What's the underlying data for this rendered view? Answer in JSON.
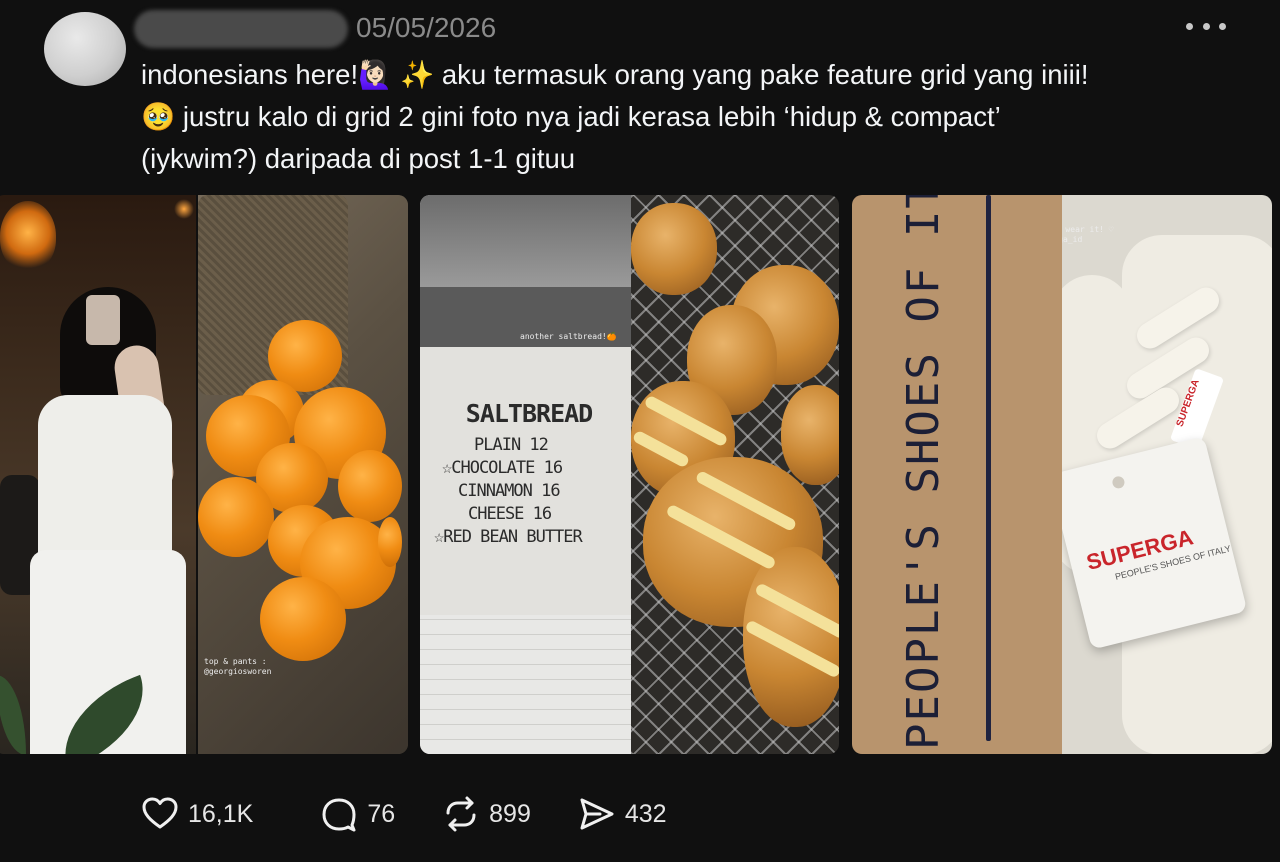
{
  "post": {
    "timestamp": "05/05/2026",
    "text_lines": [
      "indonesians here!🙋🏻‍♀️ ✨ aku termasuk orang yang pake feature grid yang iniii!",
      "🥹 justru kalo di grid 2 gini foto nya jadi kerasa lebih ‘hidup & compact’",
      "(iykwim?) daripada di post 1-1 gituu"
    ]
  },
  "media": [
    {
      "right_caption_lines": [
        "top & pants :",
        "@georgiosworen"
      ]
    },
    {
      "caption": "another saltbread!🍊",
      "menu_title": "SALTBREAD",
      "menu_lines": [
        "PLAIN 12",
        "☆CHOCOLATE 16",
        "CINNAMON 16",
        "CHEESE 16",
        "☆RED BEAN BUTTER"
      ]
    },
    {
      "box_text": "PEOPLE'S SHOES OF ITAL",
      "caption_lines": [
        "so excited to wear it! ♡",
        "@superga_id"
      ],
      "tag_logo": "SUPERGA",
      "tag_subtitle": "PEOPLE'S SHOES OF ITALY",
      "side_logo": "SUPERGA"
    }
  ],
  "actions": {
    "like": {
      "icon": "heart-icon",
      "count": "16,1K"
    },
    "reply": {
      "icon": "comment-icon",
      "count": "76"
    },
    "repost": {
      "icon": "repost-icon",
      "count": "899"
    },
    "share": {
      "icon": "send-icon",
      "count": "432"
    }
  }
}
